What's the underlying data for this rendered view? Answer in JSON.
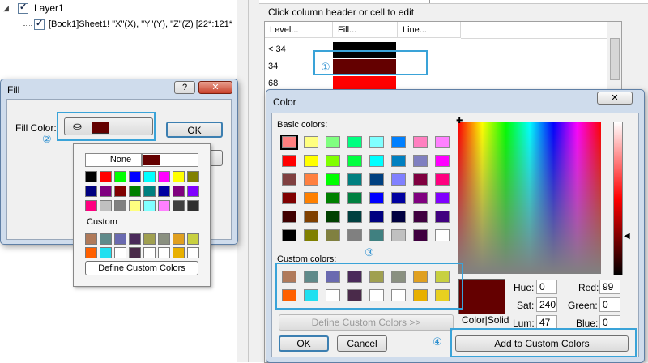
{
  "tree": {
    "layer_label": "Layer1",
    "plot_label": "[Book1]Sheet1! \"X\"(X), \"Y\"(Y), \"Z\"(Z) [22*:121*"
  },
  "grid": {
    "hint": "Click column header or cell to edit",
    "headers": [
      "Level...",
      "Fill...",
      "Line..."
    ],
    "rows": [
      {
        "level": "< 34",
        "fill": "#000000"
      },
      {
        "level": "34",
        "fill": "#640000"
      },
      {
        "level": "68",
        "fill": "#ff0000"
      },
      {
        "level": "",
        "fill": "#5cff5c"
      },
      {
        "level": "",
        "fill": "#3a0f3a"
      }
    ]
  },
  "fill_dialog": {
    "title": "Fill",
    "help_glyph": "?",
    "close_glyph": "✕",
    "fill_color_label": "Fill Color:",
    "selected_color": "#640000",
    "ok_label": "OK",
    "none_label": "None",
    "custom_label": "Custom",
    "define_label": "Define Custom Colors",
    "palette": [
      [
        "#000000",
        "#ff0000",
        "#00ff00",
        "#0000ff",
        "#00ffff",
        "#ff00ff",
        "#ffff00",
        "#808000"
      ],
      [
        "#000080",
        "#800080",
        "#800000",
        "#008000",
        "#008080",
        "#0000a0",
        "#7f007f",
        "#8000ff"
      ],
      [
        "#ff0080",
        "#c0c0c0",
        "#808080",
        "#ffff80",
        "#80ffff",
        "#ff80ff",
        "#404040",
        "#303030"
      ]
    ],
    "custom": [
      [
        "#b07a5a",
        "#5f8a8a",
        "#6a6ab0",
        "#4a2a5a",
        "#a0a050",
        "#8a9080",
        "#e0a020",
        "#c8d040"
      ],
      [
        "#ff6000",
        "#20e0f0",
        "#ffffff",
        "#4a2a4a",
        "#ffffff",
        "#ffffff",
        "#e8b000",
        "#ffffff"
      ]
    ]
  },
  "color_dialog": {
    "title": "Color",
    "close_glyph": "✕",
    "basic_label": "Basic colors:",
    "custom_label": "Custom colors:",
    "basic": [
      [
        "#ff8080",
        "#ffff80",
        "#80ff80",
        "#00ff80",
        "#80ffff",
        "#0080ff",
        "#ff80c0",
        "#ff80ff"
      ],
      [
        "#ff0000",
        "#ffff00",
        "#80ff00",
        "#00ff40",
        "#00ffff",
        "#0080c0",
        "#8080c0",
        "#ff00ff"
      ],
      [
        "#804040",
        "#ff8040",
        "#00ff00",
        "#008080",
        "#004080",
        "#8080ff",
        "#800040",
        "#ff0080"
      ],
      [
        "#800000",
        "#ff8000",
        "#008000",
        "#008040",
        "#0000ff",
        "#0000a0",
        "#800080",
        "#8000ff"
      ],
      [
        "#400000",
        "#804000",
        "#004000",
        "#004040",
        "#000080",
        "#000040",
        "#400040",
        "#400080"
      ],
      [
        "#000000",
        "#808000",
        "#808040",
        "#808080",
        "#408080",
        "#c0c0c0",
        "#400040",
        "#ffffff"
      ]
    ],
    "custom": [
      [
        "#b07a5a",
        "#5f8a8a",
        "#6a6ab0",
        "#4a2a5a",
        "#a0a050",
        "#8a9080",
        "#e0a020",
        "#c8d040"
      ],
      [
        "#ff6000",
        "#20e0f0",
        "#ffffff",
        "#4a2a4a",
        "#ffffff",
        "#ffffff",
        "#e8b000",
        "#e8d020"
      ]
    ],
    "define_label": "Define Custom Colors >>",
    "ok_label": "OK",
    "cancel_label": "Cancel",
    "add_label": "Add to Custom Colors",
    "preview_color": "#640000",
    "colorsolid_label": "Color|Solid",
    "hue_label": "Hue:",
    "hue": "0",
    "sat_label": "Sat:",
    "sat": "240",
    "lum_label": "Lum:",
    "lum": "47",
    "red_label": "Red:",
    "red": "99",
    "green_label": "Green:",
    "green": "0",
    "blue_label": "Blue:",
    "blue": "0"
  },
  "callouts": {
    "one": "①",
    "two": "②",
    "three": "③",
    "four": "④"
  }
}
